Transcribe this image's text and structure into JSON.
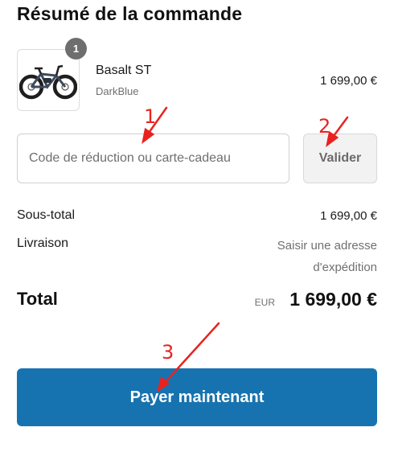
{
  "summary": {
    "title": "Résumé de la commande"
  },
  "product": {
    "quantity": "1",
    "name": "Basalt ST",
    "variant": "DarkBlue",
    "price": "1 699,00 €",
    "image_icon": "bike-icon"
  },
  "discount": {
    "placeholder": "Code de réduction ou carte-cadeau",
    "value": "",
    "apply_label": "Valider"
  },
  "totals": {
    "subtotal_label": "Sous-total",
    "subtotal_value": "1 699,00 €",
    "shipping_label": "Livraison",
    "shipping_value": "Saisir une adresse d'expédition",
    "total_label": "Total",
    "currency": "EUR",
    "total_value": "1 699,00 €"
  },
  "checkout": {
    "pay_label": "Payer maintenant"
  },
  "annotations": {
    "marker_1": "1",
    "marker_2": "2",
    "marker_3": "3",
    "color": "#e8231f"
  },
  "colors": {
    "accent": "#1773b0",
    "muted_text": "#707070"
  }
}
